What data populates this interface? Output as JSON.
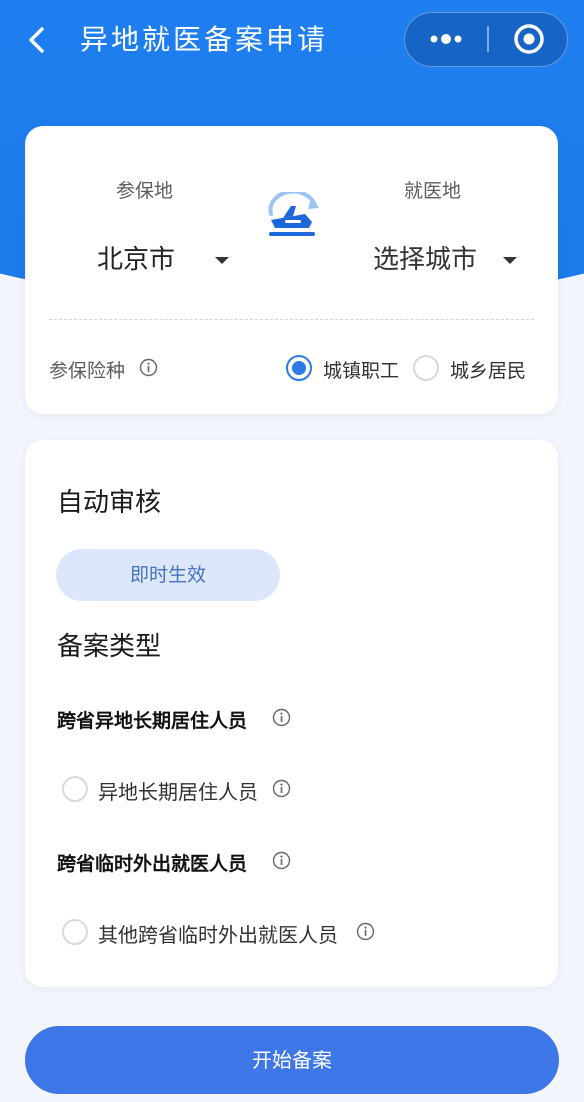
{
  "nav": {
    "title": "异地就医备案申请",
    "back_icon": "chevron-left-icon",
    "more_icon": "more-dots-icon",
    "close_icon": "target-circle-icon"
  },
  "location": {
    "insured_label": "参保地",
    "insured_city": "北京市",
    "medical_label": "就医地",
    "medical_city": "选择城市",
    "swap_icon": "plane-transfer-icon"
  },
  "insurance": {
    "label": "参保险种",
    "options": [
      {
        "label": "城镇职工",
        "checked": true
      },
      {
        "label": "城乡居民",
        "checked": false
      }
    ]
  },
  "review": {
    "title": "自动审核",
    "badge": "即时生效"
  },
  "filing": {
    "title": "备案类型",
    "groups": [
      {
        "title": "跨省异地长期居住人员",
        "option": "异地长期居住人员"
      },
      {
        "title": "跨省临时外出就医人员",
        "option": "其他跨省临时外出就医人员"
      }
    ]
  },
  "actions": {
    "start_label": "开始备案"
  },
  "colors": {
    "brand_blue": "#1f7ff0",
    "accent_blue": "#2b7bea",
    "button_blue": "#3d76e7",
    "pill_bg": "#dce7fb",
    "page_bg": "#f2f5fb"
  }
}
